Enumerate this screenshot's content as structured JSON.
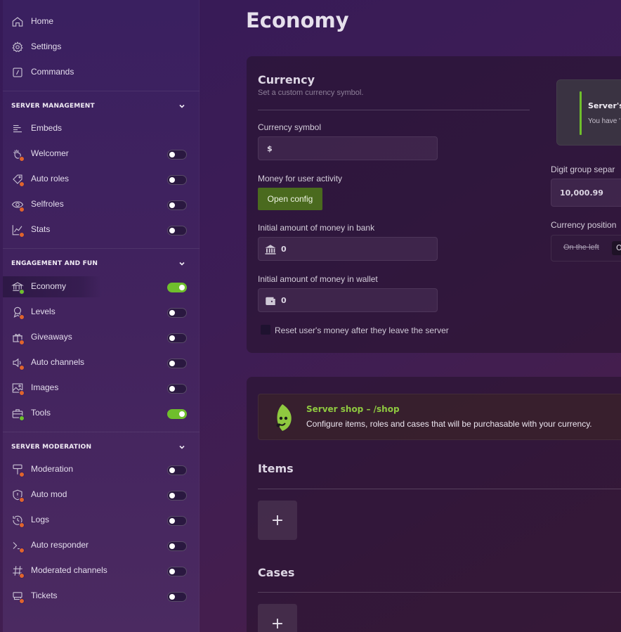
{
  "sidebar": {
    "top_items": [
      {
        "label": "Home",
        "icon": "home-icon"
      },
      {
        "label": "Settings",
        "icon": "gear-icon"
      },
      {
        "label": "Commands",
        "icon": "command-icon"
      }
    ],
    "sections": [
      {
        "title": "SERVER MANAGEMENT",
        "items": [
          {
            "label": "Embeds",
            "icon": "align-left-icon",
            "toggle": null
          },
          {
            "label": "Welcomer",
            "icon": "wave-hand-icon",
            "toggle": false
          },
          {
            "label": "Auto roles",
            "icon": "tag-icon",
            "toggle": false
          },
          {
            "label": "Selfroles",
            "icon": "eye-icon",
            "toggle": false
          },
          {
            "label": "Stats",
            "icon": "chart-line-icon",
            "toggle": false
          }
        ]
      },
      {
        "title": "ENGAGEMENT AND FUN",
        "items": [
          {
            "label": "Economy",
            "icon": "bank-icon",
            "toggle": true,
            "active": true
          },
          {
            "label": "Levels",
            "icon": "award-icon",
            "toggle": false
          },
          {
            "label": "Giveaways",
            "icon": "gift-icon",
            "toggle": false
          },
          {
            "label": "Auto channels",
            "icon": "speaker-icon",
            "toggle": false
          },
          {
            "label": "Images",
            "icon": "image-icon",
            "toggle": false
          },
          {
            "label": "Tools",
            "icon": "toolbox-icon",
            "toggle": true
          }
        ]
      },
      {
        "title": "SERVER MODERATION",
        "items": [
          {
            "label": "Moderation",
            "icon": "hammer-icon",
            "toggle": false
          },
          {
            "label": "Auto mod",
            "icon": "shield-alert-icon",
            "toggle": false
          },
          {
            "label": "Logs",
            "icon": "history-icon",
            "toggle": false
          },
          {
            "label": "Auto responder",
            "icon": "terminal-icon",
            "toggle": false
          },
          {
            "label": "Moderated channels",
            "icon": "hash-icon",
            "toggle": false
          },
          {
            "label": "Tickets",
            "icon": "ticket-icon",
            "toggle": false
          }
        ]
      }
    ]
  },
  "page": {
    "title": "Economy"
  },
  "currency": {
    "title": "Currency",
    "subtitle": "Set a custom currency symbol.",
    "symbol_label": "Currency symbol",
    "symbol_value": "$",
    "activity_label": "Money for user activity",
    "open_config": "Open config",
    "bank_label": "Initial amount of money in bank",
    "bank_value": "0",
    "wallet_label": "Initial amount of money in wallet",
    "wallet_value": "0",
    "reset_label": "Reset user's money after they leave the server",
    "digit_label": "Digit group separ",
    "digit_value": "10,000.99",
    "position_label": "Currency position",
    "position_option1": "On the left",
    "position_option2": "O",
    "preview_title": "Server's",
    "preview_text": "You have '"
  },
  "shop": {
    "title": "Server shop – /shop",
    "description": "Configure items, roles and cases that will be purchasable with your currency.",
    "items_title": "Items",
    "cases_title": "Cases",
    "add_label": "+"
  },
  "colors": {
    "accent_green": "#6fbf2c",
    "status_off": "#e0642c"
  }
}
